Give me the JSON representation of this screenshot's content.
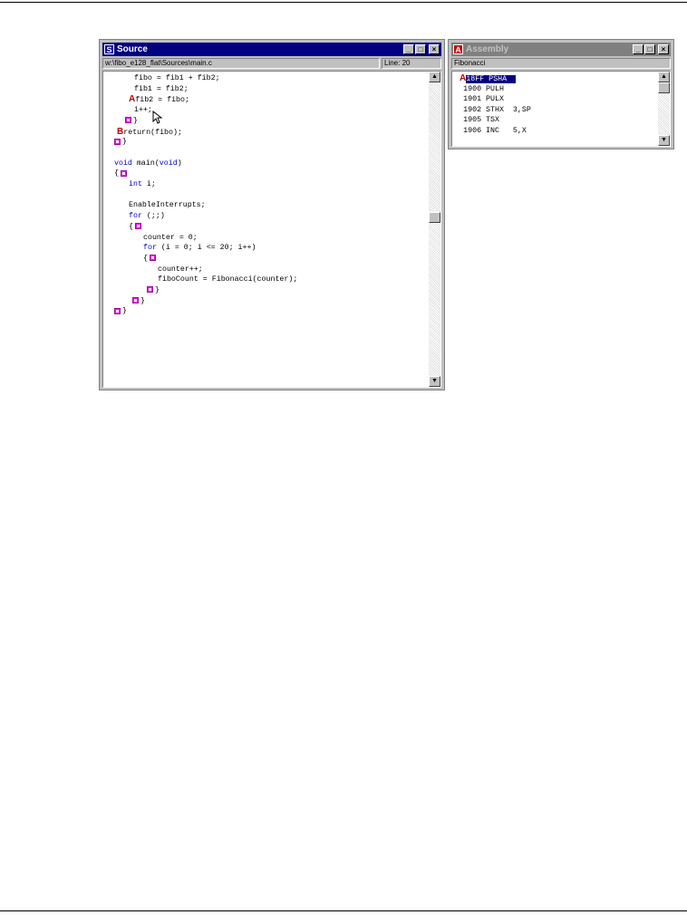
{
  "source_window": {
    "title": "Source",
    "icon_letter": "S",
    "path": "w:\\fibo_e128_flat\\Sources\\main.c",
    "line_indicator": "Line: 20",
    "buttons": [
      "minimize",
      "maximize",
      "close"
    ],
    "lines": [
      {
        "text": "fibo = fib1 + fib2;"
      },
      {
        "text": "fib1 = fib2;"
      },
      {
        "bp": "A",
        "text": "fib2 = fibo;"
      },
      {
        "text": "i++;"
      },
      {
        "text": "}"
      },
      {
        "bp": "B",
        "text": "return(fibo);"
      },
      {
        "text": "}"
      },
      {
        "text": ""
      },
      {
        "kw1": "void",
        "mid": " main(",
        "kw2": "void",
        "end": ")"
      },
      {
        "text": "{"
      },
      {
        "kw1": "int",
        "end": " i;"
      },
      {
        "text": ""
      },
      {
        "text": "EnableInterrupts;"
      },
      {
        "kw1": "for",
        "end": " (;;)"
      },
      {
        "text": "{"
      },
      {
        "text": "counter = 0;"
      },
      {
        "kw1": "for",
        "end": " (i = 0; i <= 20; i++)"
      },
      {
        "text": "{"
      },
      {
        "text": "counter++;"
      },
      {
        "text": "fiboCount = Fibonacci(counter);"
      },
      {
        "text": "}"
      },
      {
        "text": "}"
      },
      {
        "text": "}"
      }
    ]
  },
  "assembly_window": {
    "title": "Assembly",
    "icon_letter": "A",
    "function_name": "Fibonacci",
    "bp": "A",
    "lines": [
      {
        "addr": "18FF",
        "mnem": "PSHA",
        "op": ""
      },
      {
        "addr": "1900",
        "mnem": "PULH",
        "op": ""
      },
      {
        "addr": "1901",
        "mnem": "PULX",
        "op": ""
      },
      {
        "addr": "1902",
        "mnem": "STHX",
        "op": "3,SP"
      },
      {
        "addr": "1905",
        "mnem": "TSX",
        "op": ""
      },
      {
        "addr": "1906",
        "mnem": "INC",
        "op": "5,X"
      }
    ]
  }
}
